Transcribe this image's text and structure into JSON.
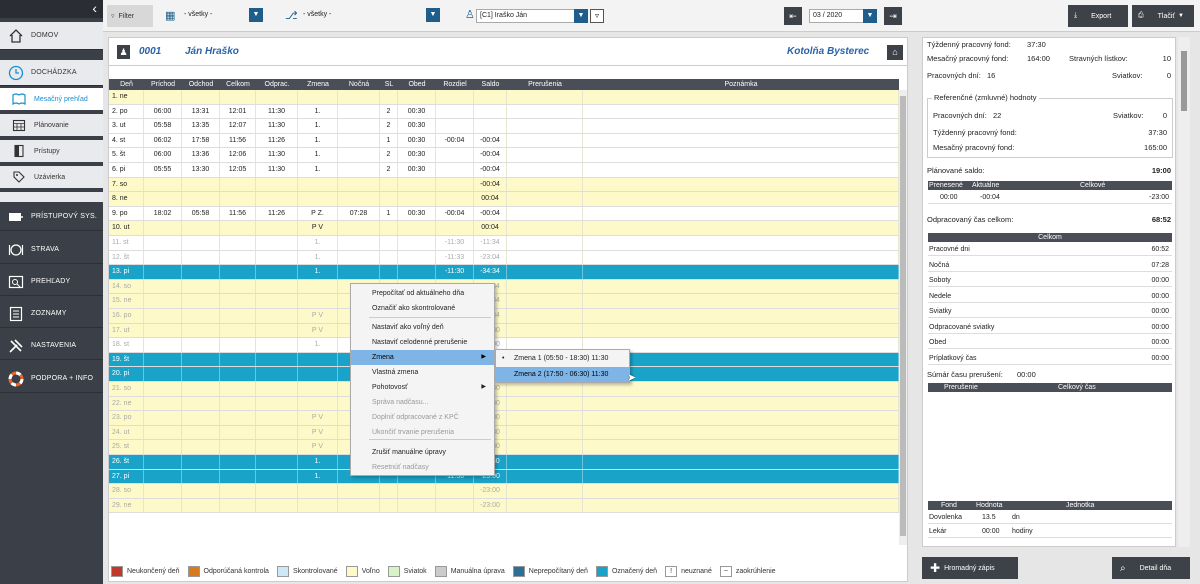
{
  "sidebar": {
    "items": [
      {
        "label": "DOMOV",
        "icon": "home-icon"
      },
      {
        "label": "DOCHÁDZKA",
        "icon": "clock-icon"
      },
      {
        "label": "Mesačný prehľad",
        "icon": "book-icon"
      },
      {
        "label": "Plánovanie",
        "icon": "calendar-icon"
      },
      {
        "label": "Prístupy",
        "icon": "door-icon"
      },
      {
        "label": "Uzávierka",
        "icon": "tags-icon"
      },
      {
        "label": "PRÍSTUPOVÝ SYS.",
        "icon": "card-icon"
      },
      {
        "label": "STRAVA",
        "icon": "plate-icon"
      },
      {
        "label": "PREHĽADY",
        "icon": "report-icon"
      },
      {
        "label": "ZOZNAMY",
        "icon": "list-icon"
      },
      {
        "label": "NASTAVENIA",
        "icon": "tools-icon"
      },
      {
        "label": "PODPORA + INFO",
        "icon": "lifebuoy-icon"
      }
    ]
  },
  "toolbar": {
    "filter": "Filter",
    "sel1": "- všetky -",
    "sel2": "- všetky -",
    "employee": "[C1] Iraško Ján",
    "period": "03 / 2020",
    "export": "Export",
    "print": "Tlačiť"
  },
  "employee": {
    "id": "0001",
    "name": "Ján Hraško",
    "company": "Kotolňa Bysterec"
  },
  "grid": {
    "headers": [
      "Deň",
      "Príchod",
      "Odchod",
      "Celkom",
      "Odprac.",
      "Zmena",
      "Nočná",
      "SL",
      "Obed",
      "Rozdiel",
      "Saldo",
      "Prerušenia",
      "Poznámka"
    ],
    "rows": [
      {
        "t": "we",
        "c": [
          "1. ne",
          "",
          "",
          "",
          "",
          "",
          "",
          "",
          "",
          "",
          "",
          "",
          ""
        ]
      },
      {
        "t": "wd",
        "c": [
          "2. po",
          "06:00",
          "13:31",
          "12:01",
          "11:30",
          "1.",
          "",
          "2",
          "00:30",
          "",
          "",
          "",
          ""
        ]
      },
      {
        "t": "wd",
        "c": [
          "3. ut",
          "05:58",
          "13:35",
          "12:07",
          "11:30",
          "1.",
          "",
          "2",
          "00:30",
          "",
          "",
          "",
          ""
        ]
      },
      {
        "t": "wd",
        "c": [
          "4. st",
          "06:02",
          "17:58",
          "11:56",
          "11:26",
          "1.",
          "",
          "1",
          "00:30",
          "-00:04",
          "-00:04",
          "",
          ""
        ]
      },
      {
        "t": "wd",
        "c": [
          "5. št",
          "06:00",
          "13:36",
          "12:06",
          "11:30",
          "1.",
          "",
          "2",
          "00:30",
          "",
          "-00:04",
          "",
          ""
        ]
      },
      {
        "t": "wd",
        "c": [
          "6. pi",
          "05:55",
          "13:30",
          "12:05",
          "11:30",
          "1.",
          "",
          "2",
          "00:30",
          "",
          "-00:04",
          "",
          ""
        ]
      },
      {
        "t": "we",
        "c": [
          "7. so",
          "",
          "",
          "",
          "",
          "",
          "",
          "",
          "",
          "",
          "-00:04",
          "",
          ""
        ]
      },
      {
        "t": "we",
        "c": [
          "8. ne",
          "",
          "",
          "",
          "",
          "",
          "",
          "",
          "",
          "",
          "00:04",
          "",
          ""
        ]
      },
      {
        "t": "wd",
        "c": [
          "9. po",
          "18:02",
          "05:58",
          "11:56",
          "11:26",
          "P Z.",
          "07:28",
          "1",
          "00:30",
          "-00:04",
          "-00:04",
          "",
          ""
        ]
      },
      {
        "t": "we",
        "c": [
          "10. ut",
          "",
          "",
          "",
          "",
          "P V",
          "",
          "",
          "",
          "",
          "00:04",
          "",
          ""
        ]
      },
      {
        "t": "wd dim",
        "c": [
          "11. st",
          "",
          "",
          "",
          "",
          "1.",
          "",
          "",
          "",
          "-11:30",
          "-11:34",
          "",
          ""
        ]
      },
      {
        "t": "wd dim",
        "c": [
          "12. št",
          "",
          "",
          "",
          "",
          "1.",
          "",
          "",
          "",
          "-11:33",
          "-23:04",
          "",
          ""
        ]
      },
      {
        "t": "mk",
        "c": [
          "13. pi",
          "",
          "",
          "",
          "",
          "1.",
          "",
          "",
          "",
          "-11:30",
          "-34:34",
          "",
          ""
        ]
      },
      {
        "t": "we dim",
        "c": [
          "14. so",
          "",
          "",
          "",
          "",
          "",
          "",
          "",
          "",
          "",
          "-34:34",
          "",
          ""
        ]
      },
      {
        "t": "we dim",
        "c": [
          "15. ne",
          "",
          "",
          "",
          "",
          "",
          "",
          "",
          "",
          "",
          "-34:34",
          "",
          ""
        ]
      },
      {
        "t": "we dim",
        "c": [
          "16. po",
          "",
          "",
          "",
          "",
          "P V",
          "",
          "",
          "",
          "",
          "-34:34",
          "",
          ""
        ]
      },
      {
        "t": "we dim",
        "c": [
          "17. ut",
          "",
          "",
          "",
          "",
          "P V",
          "",
          "",
          "",
          "",
          "-34:30",
          "",
          ""
        ]
      },
      {
        "t": "wd dim",
        "c": [
          "18. st",
          "",
          "",
          "",
          "",
          "1.",
          "",
          "",
          "",
          "",
          "-23:00",
          "",
          ""
        ]
      },
      {
        "t": "mk",
        "c": [
          "19. št",
          "",
          "",
          "",
          "",
          "",
          "",
          "",
          "",
          "",
          "-23:00",
          "",
          ""
        ]
      },
      {
        "t": "mk",
        "c": [
          "20. pi",
          "",
          "",
          "",
          "",
          "",
          "",
          "",
          "",
          "",
          "-34:30",
          "",
          ""
        ]
      },
      {
        "t": "we dim",
        "c": [
          "21. so",
          "",
          "",
          "",
          "",
          "",
          "",
          "",
          "",
          "",
          "-34:30",
          "",
          ""
        ]
      },
      {
        "t": "we dim",
        "c": [
          "22. ne",
          "",
          "",
          "",
          "",
          "",
          "",
          "",
          "",
          "",
          "-34:30",
          "",
          ""
        ]
      },
      {
        "t": "we dim",
        "c": [
          "23. po",
          "",
          "",
          "",
          "",
          "P V",
          "",
          "",
          "",
          "",
          "-34:30",
          "",
          ""
        ]
      },
      {
        "t": "we dim",
        "c": [
          "24. ut",
          "",
          "",
          "",
          "",
          "P V",
          "",
          "",
          "",
          "",
          "-34:30",
          "",
          ""
        ]
      },
      {
        "t": "we dim",
        "c": [
          "25. st",
          "",
          "",
          "",
          "",
          "P V",
          "",
          "",
          "",
          "",
          "-34:30",
          "",
          ""
        ]
      },
      {
        "t": "mk",
        "c": [
          "26. št",
          "",
          "",
          "",
          "",
          "1.",
          "",
          "",
          "",
          "-11:30",
          "-11:30",
          "",
          ""
        ]
      },
      {
        "t": "mk",
        "c": [
          "27. pi",
          "",
          "",
          "",
          "",
          "1.",
          "",
          "",
          "",
          "-11:30",
          "-23:00",
          "",
          ""
        ]
      },
      {
        "t": "we dim",
        "c": [
          "28. so",
          "",
          "",
          "",
          "",
          "",
          "",
          "",
          "",
          "",
          "-23:00",
          "",
          ""
        ]
      },
      {
        "t": "we dim",
        "c": [
          "29. ne",
          "",
          "",
          "",
          "",
          "",
          "",
          "",
          "",
          "",
          "-23:00",
          "",
          ""
        ]
      }
    ]
  },
  "menu": {
    "items": [
      "Prepočítať od aktuálneho dňa",
      "Označiť ako skontrolované",
      "Nastaviť ako voľný deň",
      "Nastaviť celodenné prerušenie",
      "Zmena",
      "Vlastná zmena",
      "Pohotovosť",
      "Správa nadčasu...",
      "Doplniť odpracované z KPČ",
      "Ukončiť trvanie prerušenia",
      "Zrušiť manuálne úpravy",
      "Resetnúť nadčasy"
    ],
    "sub": [
      "Zmena 1 (05:50 - 18:30) 11:30",
      "Zmena 2 (17:50 - 06:30) 11:30"
    ]
  },
  "legend": [
    {
      "label": "Neukončený deň",
      "color": "#c0392b"
    },
    {
      "label": "Odporúčaná kontrola",
      "color": "#d97a1e"
    },
    {
      "label": "Skontrolované",
      "color": "#cfe8f7"
    },
    {
      "label": "Voľno",
      "color": "#fdf9c8"
    },
    {
      "label": "Sviatok",
      "color": "#d8f3c6"
    },
    {
      "label": "Manuálna úprava",
      "color": "#cccccc"
    },
    {
      "label": "Neprepočítaný deň",
      "color": "#2e6f96"
    },
    {
      "label": "Označený deň",
      "color": "#1aa3c8"
    },
    {
      "label": "neuznané",
      "sym": "!"
    },
    {
      "label": "zaokrúhlenie",
      "sym": "~"
    }
  ],
  "right": {
    "wf_label": "Týždenný pracovný fond:",
    "wf_val": "37:30",
    "mf_label": "Mesačný pracovný fond:",
    "mf_val": "164:00",
    "sl_label": "Stravných lístkov:",
    "sl_val": "10",
    "pd_label": "Pracovných dní:",
    "pd_val": "16",
    "sv_label": "Sviatkov:",
    "sv_val": "0",
    "ref_title": "Referenčné (zmluvné) hodnoty",
    "ref_pd_label": "Pracovných dní:",
    "ref_pd_val": "22",
    "ref_sv_label": "Sviatkov:",
    "ref_sv_val": "0",
    "ref_wf_label": "Týždenný pracovný fond:",
    "ref_wf_val": "37:30",
    "ref_mf_label": "Mesačný pracovný fond:",
    "ref_mf_val": "165:00",
    "plan_label": "Plánované saldo:",
    "plan_val": "19:00",
    "saldo_hdr": [
      "Prenesené",
      "Aktuálne",
      "Celkové"
    ],
    "saldo_vals": [
      "00:00",
      "-00:04",
      "-23:00"
    ],
    "odp_label": "Odpracovaný čas celkom:",
    "odp_val": "68:52",
    "celkom_hdr": "Celkom",
    "rows": [
      [
        "Pracovné dni",
        "60:52"
      ],
      [
        "Nočná",
        "07:28"
      ],
      [
        "Soboty",
        "00:00"
      ],
      [
        "Nedele",
        "00:00"
      ],
      [
        "Sviatky",
        "00:00"
      ],
      [
        "Odpracované sviatky",
        "00:00"
      ],
      [
        "Obed",
        "00:00"
      ],
      [
        "Príplatkový čas",
        "00:00"
      ]
    ],
    "sum_label": "Súmár času prerušení:",
    "sum_val": "00:00",
    "sum_hdr": [
      "Prerušenie",
      "Celkový čas"
    ],
    "fond_hdr": [
      "Fond",
      "Hodnota",
      "Jednotka"
    ],
    "fond_rows": [
      [
        "Dovolenka",
        "13.5",
        "dn"
      ],
      [
        "Lekár",
        "00:00",
        "hodiny"
      ]
    ]
  },
  "bottom": {
    "bulk": "Hromadný zápis",
    "detail": "Detail dňa"
  }
}
